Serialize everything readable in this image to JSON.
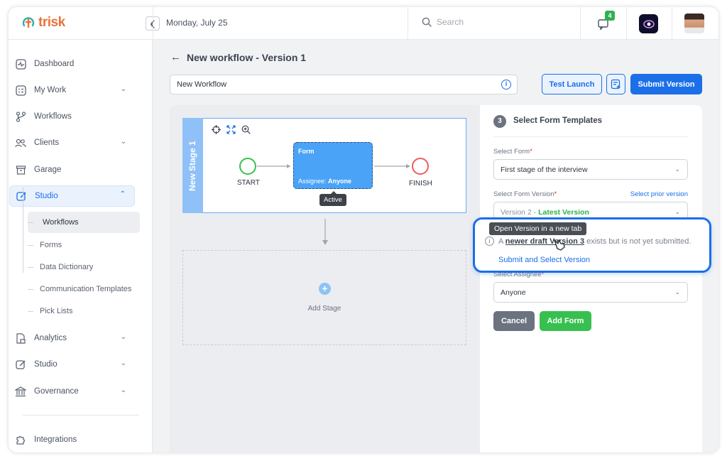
{
  "app": {
    "name": "trisk",
    "brand_color": "#e8743b",
    "accent_color": "#1b6fe8"
  },
  "header": {
    "date": "Monday, July 25",
    "search_placeholder": "Search",
    "notifications_count": "4"
  },
  "sidebar": {
    "items": [
      {
        "label": "Dashboard",
        "icon": "dashboard-icon"
      },
      {
        "label": "My Work",
        "icon": "my-work-icon"
      },
      {
        "label": "Workflows",
        "icon": "workflows-icon"
      },
      {
        "label": "Clients",
        "icon": "clients-icon"
      },
      {
        "label": "Garage",
        "icon": "garage-icon"
      },
      {
        "label": "Studio",
        "icon": "studio-icon"
      },
      {
        "label": "Analytics",
        "icon": "analytics-icon"
      },
      {
        "label": "Studio",
        "icon": "studio-icon"
      },
      {
        "label": "Governance",
        "icon": "governance-icon"
      },
      {
        "label": "Integrations",
        "icon": "integrations-icon"
      }
    ],
    "studio_sub": [
      "Workflows",
      "Forms",
      "Data Dictionary",
      "Communication Templates",
      "Pick Lists"
    ]
  },
  "main": {
    "title": "New workflow - Version 1",
    "workflow_name": "New Workflow",
    "test_launch": "Test Launch",
    "submit_version": "Submit Version"
  },
  "canvas": {
    "stage_label": "New Stage 1",
    "start": "START",
    "finish": "FINISH",
    "form_title": "Form",
    "assignee_prefix": "Assignee:",
    "assignee_value": "Anyone",
    "active_tag": "Active",
    "add_stage": "Add Stage"
  },
  "panel": {
    "step": "3",
    "title": "Select Form Templates",
    "form_label": "Select Form",
    "form_value": "First stage of the interview",
    "version_label": "Select Form Version",
    "prior_version_link": "Select prior version",
    "version_value": "Version 2 - ",
    "version_status": "Latest Version",
    "assignee_label": "Select Assignee",
    "assignee_value": "Anyone",
    "cancel": "Cancel",
    "add_form": "Add Form"
  },
  "callout": {
    "tooltip": "Open Version in a new tab",
    "text_before": "A",
    "link_text": "newer draft Version 3",
    "text_after": "exists but is not yet submitted.",
    "action": "Submit and Select Version"
  }
}
